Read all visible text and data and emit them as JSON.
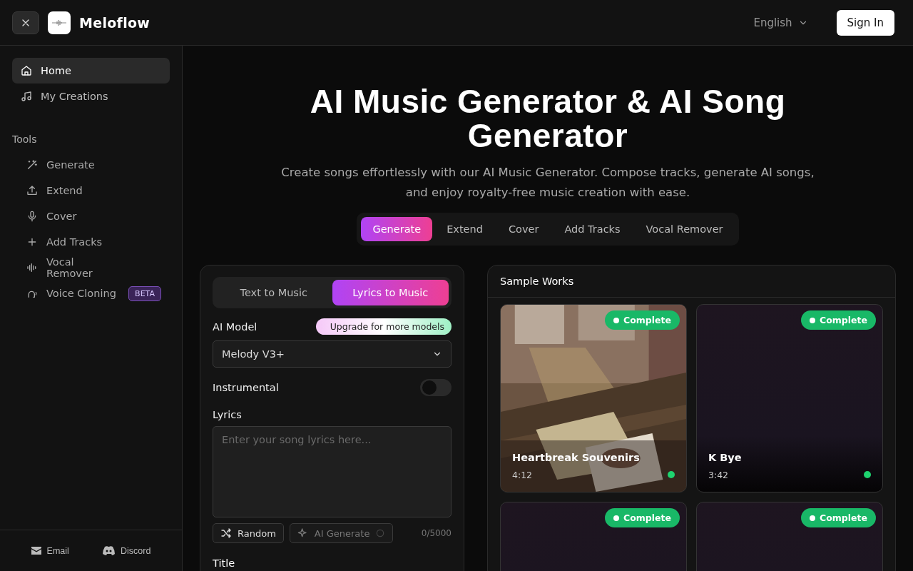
{
  "header": {
    "brand": "Meloflow",
    "language": "English",
    "sign_in": "Sign In"
  },
  "sidebar": {
    "nav": [
      {
        "label": "Home",
        "selected": true
      },
      {
        "label": "My Creations",
        "selected": false
      }
    ],
    "tools_heading": "Tools",
    "tools": [
      {
        "label": "Generate"
      },
      {
        "label": "Extend"
      },
      {
        "label": "Cover"
      },
      {
        "label": "Add Tracks"
      },
      {
        "label": "Vocal Remover"
      },
      {
        "label": "Voice Cloning",
        "badge": "BETA"
      }
    ],
    "footer": [
      "Email",
      "Discord"
    ]
  },
  "hero": {
    "title": "AI Music Generator & AI Song Generator",
    "subtitle": "Create songs effortlessly with our AI Music Generator. Compose tracks, generate AI songs, and enjoy royalty-free music creation with ease."
  },
  "tool_tabs": [
    {
      "label": "Generate",
      "selected": true
    },
    {
      "label": "Extend",
      "selected": false
    },
    {
      "label": "Cover",
      "selected": false
    },
    {
      "label": "Add Tracks",
      "selected": false
    },
    {
      "label": "Vocal Remover",
      "selected": false
    }
  ],
  "form": {
    "mode_tabs": [
      {
        "label": "Text to Music",
        "selected": false
      },
      {
        "label": "Lyrics to Music",
        "selected": true
      }
    ],
    "model_label": "AI Model",
    "upgrade": "Upgrade for more models",
    "model_value": "Melody V3+",
    "instrumental": {
      "label": "Instrumental",
      "on": false
    },
    "lyrics_label": "Lyrics",
    "lyrics_placeholder": "Enter your song lyrics here...",
    "random": "Random",
    "ai_generate": "AI Generate",
    "counter": "0/5000",
    "title_label": "Title"
  },
  "samples": {
    "heading": "Sample Works",
    "items": [
      {
        "kind": "picture",
        "status": "Complete",
        "title": "Heartbreak Souvenirs",
        "duration": "4:12"
      },
      {
        "kind": "plain",
        "status": "Complete",
        "title": "K Bye",
        "duration": "3:42"
      },
      {
        "kind": "plain",
        "status": "Complete"
      },
      {
        "kind": "plain",
        "status": "Complete"
      }
    ]
  }
}
